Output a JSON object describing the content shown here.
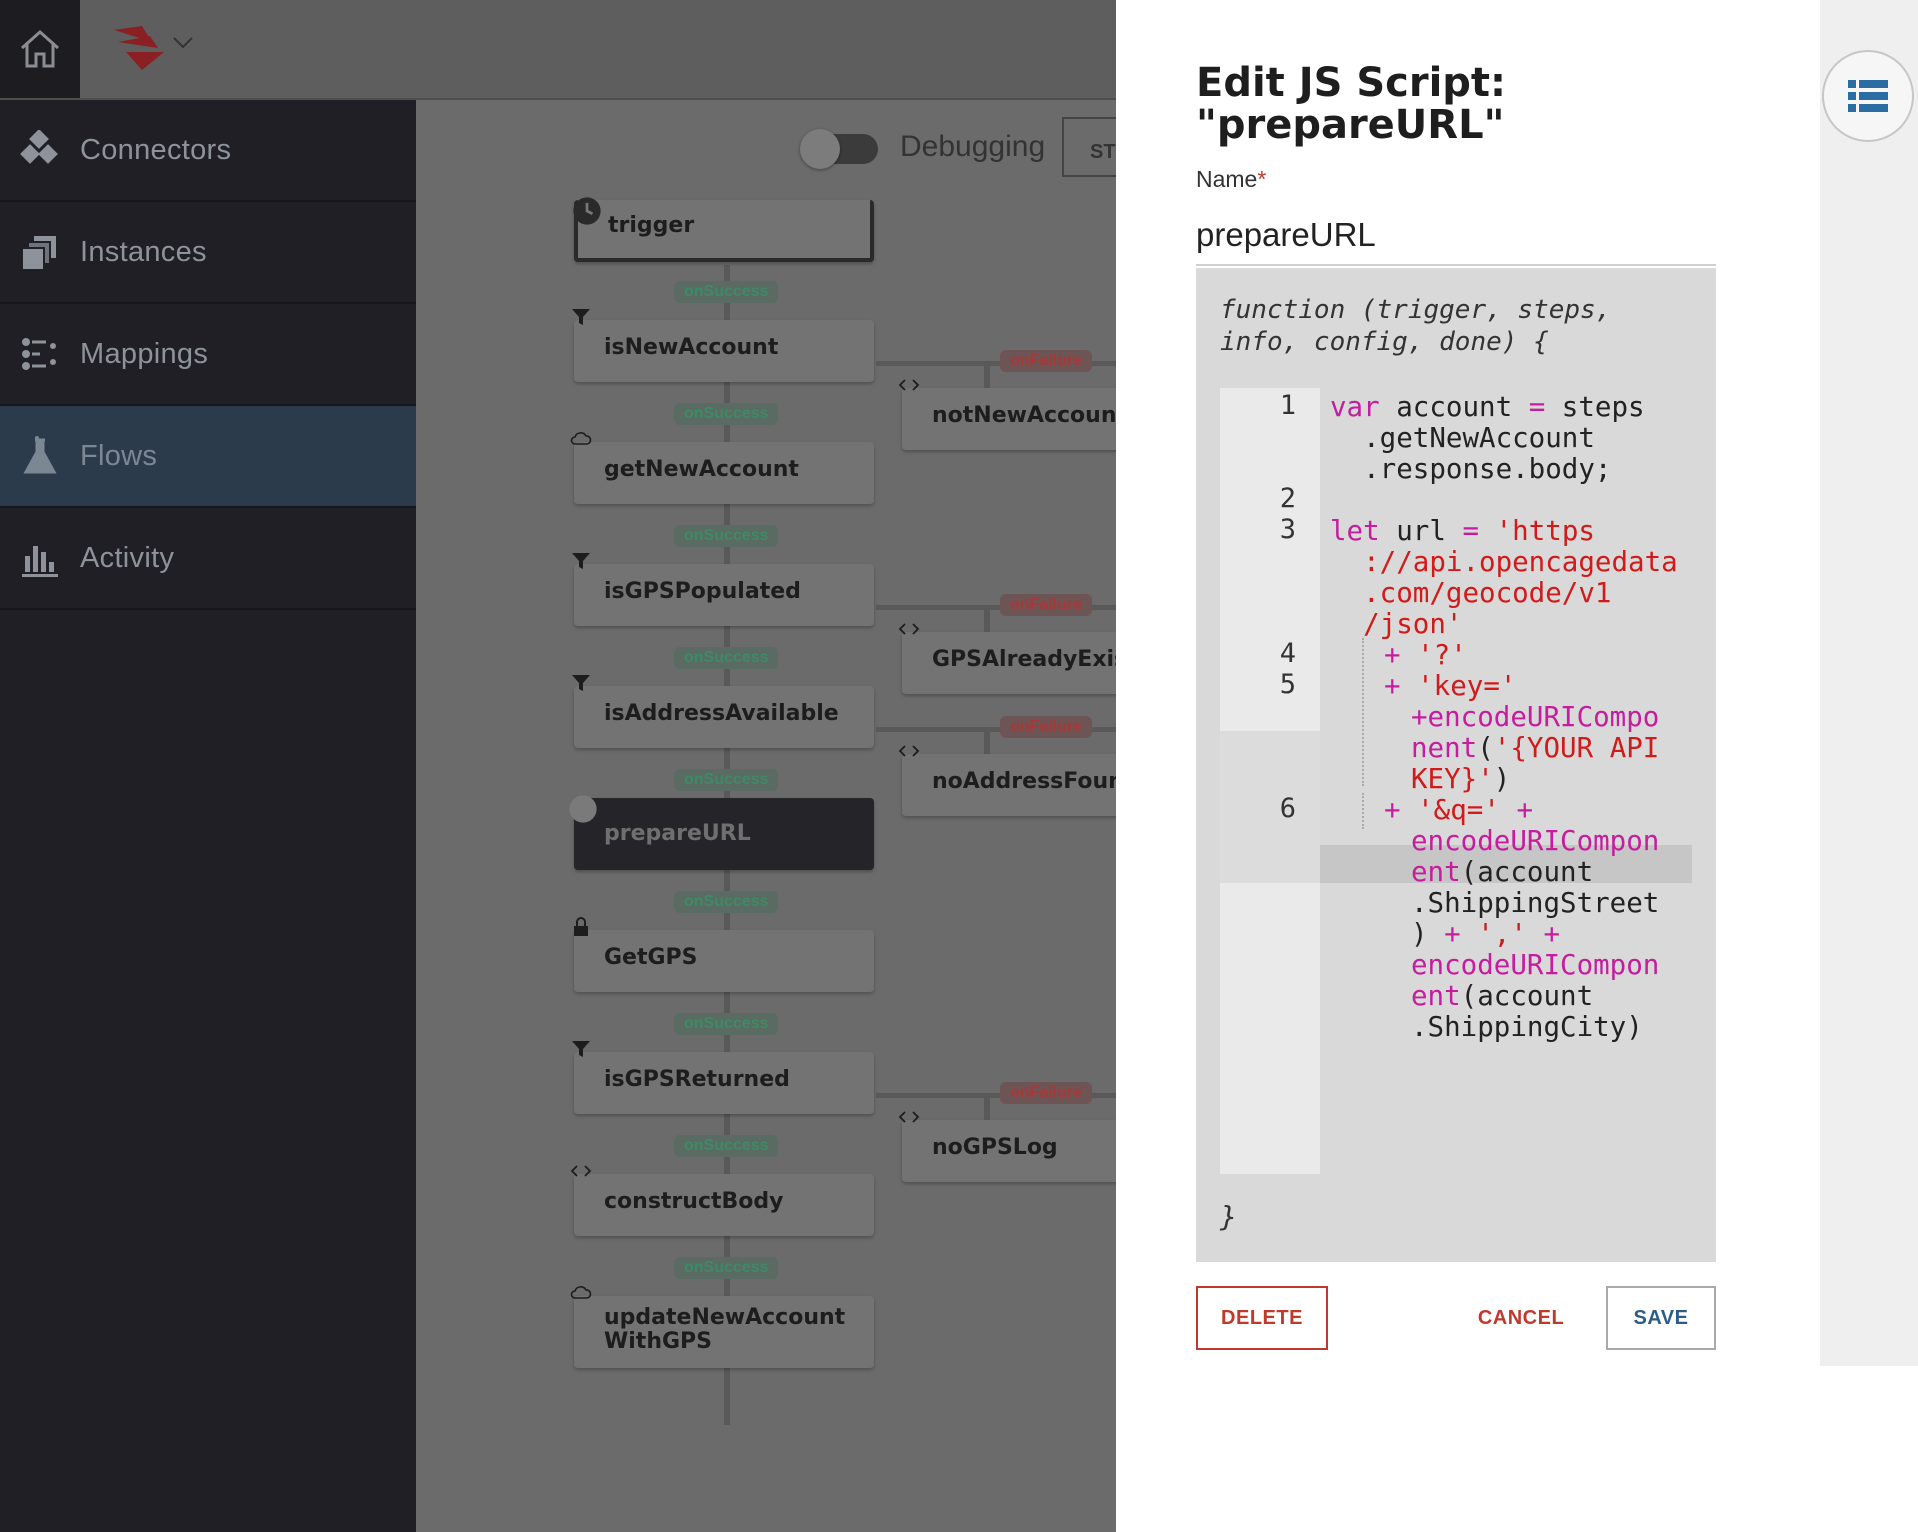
{
  "nav": {
    "items": [
      {
        "label": "Connectors",
        "icon": "connectors-icon"
      },
      {
        "label": "Instances",
        "icon": "instances-icon"
      },
      {
        "label": "Mappings",
        "icon": "mappings-icon"
      },
      {
        "label": "Flows",
        "icon": "flask-icon",
        "active": true
      },
      {
        "label": "Activity",
        "icon": "bar-chart-icon"
      }
    ]
  },
  "canvas": {
    "debug_label": "Debugging",
    "start_label": "ST",
    "edge_success": "onSuccess",
    "edge_failure": "onFailure",
    "nodes": {
      "trigger": "trigger",
      "isNewAccount": "isNewAccount",
      "getNewAccount": "getNewAccount",
      "isGPSPopulated": "isGPSPopulated",
      "isAddressAvailable": "isAddressAvailable",
      "prepareURL": "prepareURL",
      "GetGPS": "GetGPS",
      "isGPSReturned": "isGPSReturned",
      "constructBody": "constructBody",
      "updateNewAccountWithGPS": "updateNewAccountWithGPS",
      "notNewAccountLog": "notNewAccountL",
      "GPSAlreadyExists": "GPSAlreadyExists",
      "noAddressFound": "noAddressFound",
      "noGPSLog": "noGPSLog"
    }
  },
  "panel": {
    "title": "Edit JS Script: \"prepareURL\"",
    "name_label": "Name",
    "required_mark": "*",
    "name_value": "prepareURL",
    "signature": "function (trigger, steps, info, config, done) {",
    "closing_brace": "}",
    "code_lines": [
      {
        "num": "1",
        "text": [
          "var",
          " account ",
          "=",
          " steps",
          "  .getNewAccount",
          "  .response.body;"
        ]
      },
      {
        "num": "2"
      },
      {
        "num": "3",
        "text": [
          "let",
          " url ",
          "=",
          " 'https",
          "  ://api.opencagedata",
          "  .com/geocode/v1",
          "  /json'"
        ]
      },
      {
        "num": "4",
        "text": [
          "+",
          " '?'"
        ]
      },
      {
        "num": "5",
        "text": [
          "+",
          " 'key='",
          "+encodeURICompo",
          "nent",
          "(",
          "'{YOUR API",
          "KEY}'",
          ")"
        ]
      },
      {
        "num": "6",
        "text": [
          "+",
          " '&q='",
          " +",
          "encodeURICompon",
          "ent",
          "(account",
          ".ShippingStreet",
          ")",
          " + ",
          "','",
          " +",
          "encodeURICompon",
          "ent",
          "(account",
          ".ShippingCity)"
        ]
      }
    ],
    "delete_label": "DELETE",
    "cancel_label": "CANCEL",
    "save_label": "SAVE"
  },
  "colors": {
    "accent_red": "#c0392b",
    "save_blue": "#2c5d8a",
    "sidebar_bg": "#1f1f25",
    "active_nav": "#2c3b4b"
  }
}
